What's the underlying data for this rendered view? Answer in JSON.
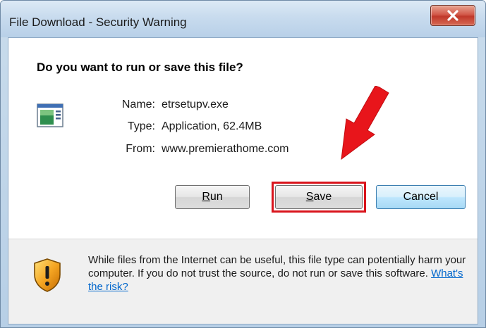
{
  "window": {
    "title": "File Download - Security Warning"
  },
  "dialog": {
    "question": "Do you want to run or save this file?",
    "file": {
      "icon": "application-file-icon",
      "name_label": "Name:",
      "name_value": "etrsetupv.exe",
      "type_label": "Type:",
      "type_value": "Application, 62.4MB",
      "from_label": "From:",
      "from_value": "www.premierathome.com"
    },
    "buttons": {
      "run_mnemonic": "R",
      "run_rest": "un",
      "save_mnemonic": "S",
      "save_rest": "ave",
      "cancel": "Cancel"
    },
    "warning": {
      "icon": "shield-warning-icon",
      "text": "While files from the Internet can be useful, this file type can potentially harm your computer. If you do not trust the source, do not run or save this software.",
      "link": "What's the risk?"
    }
  },
  "annotation": {
    "arrow_color": "#e8151b",
    "highlight_color": "#d9141c"
  }
}
